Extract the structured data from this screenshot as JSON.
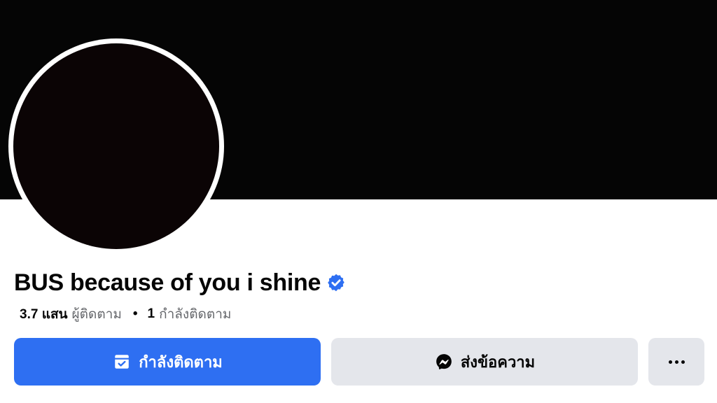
{
  "profile": {
    "name": "BUS because of you i shine",
    "verified": true
  },
  "stats": {
    "followers_count": "3.7 แสน",
    "followers_label": "ผู้ติดตาม",
    "separator": "•",
    "following_count": "1",
    "following_label": "กำลังติดตาม"
  },
  "actions": {
    "follow_label": "กำลังติดตาม",
    "message_label": "ส่งข้อความ"
  },
  "icons": {
    "verified": "verified-badge-icon",
    "follow": "following-check-icon",
    "message": "messenger-icon",
    "more": "more-dots-icon"
  },
  "colors": {
    "accent": "#2e6ff2",
    "verified": "#2e6ff2",
    "secondary_button": "#e4e6eb",
    "cover": "#050505"
  }
}
